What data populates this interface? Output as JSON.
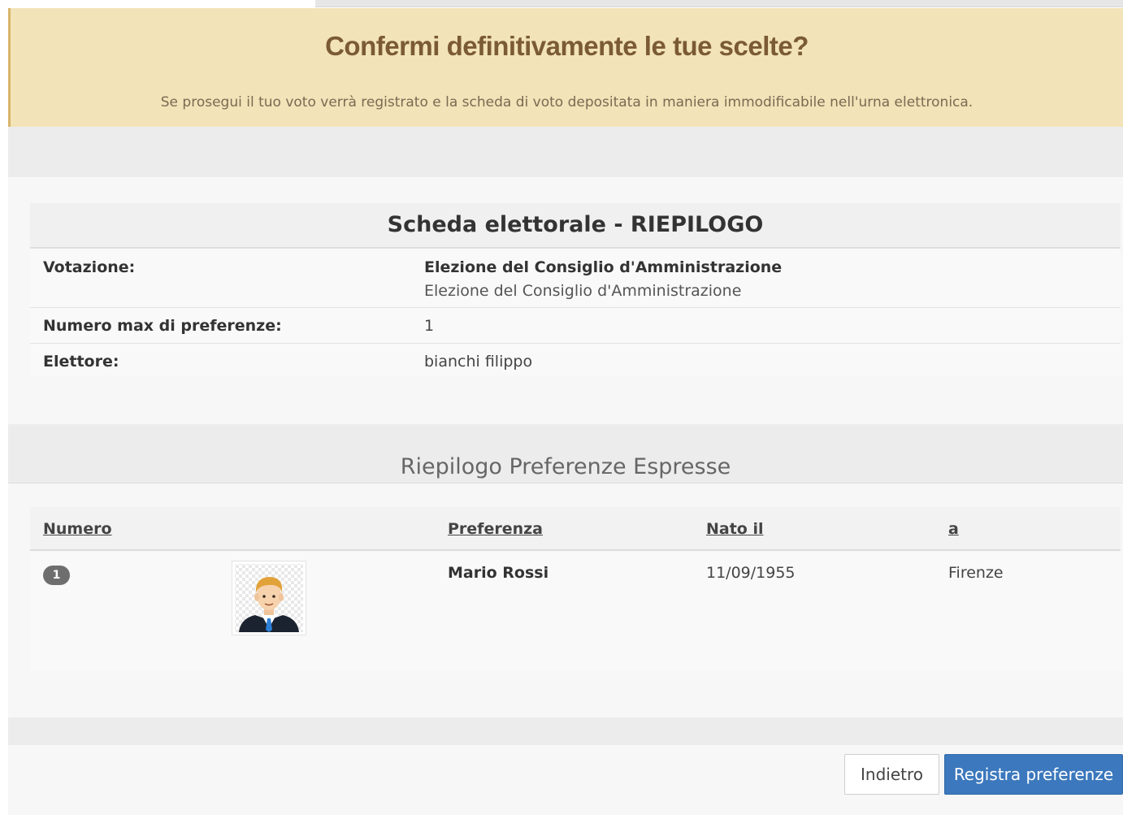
{
  "alert": {
    "title": "Confermi definitivamente le tue scelte?",
    "message": "Se prosegui il tuo voto verrà registrato e la scheda di voto depositata in maniera immodificabile nell'urna elettronica."
  },
  "summary": {
    "title": "Scheda elettorale - RIEPILOGO",
    "rows": [
      {
        "label": "Votazione:",
        "value": "Elezione del Consiglio d'Amministrazione",
        "subvalue": "Elezione del Consiglio d'Amministrazione"
      },
      {
        "label": "Numero max di preferenze:",
        "value": "1"
      },
      {
        "label": "Elettore:",
        "value": "bianchi filippo"
      }
    ]
  },
  "preferences": {
    "title": "Riepilogo Preferenze Espresse",
    "columns": [
      "Numero",
      "Preferenza",
      "Nato il",
      "a"
    ],
    "rows": [
      {
        "number": "1",
        "name": "Mario Rossi",
        "born_on": "11/09/1955",
        "born_in": "Firenze",
        "avatar": "person-avatar-icon"
      }
    ]
  },
  "actions": {
    "back_label": "Indietro",
    "submit_label": "Registra preferenze"
  },
  "colors": {
    "alert_bg": "#f2e3b8",
    "alert_title": "#7b5a36",
    "primary": "#3c78bd"
  }
}
